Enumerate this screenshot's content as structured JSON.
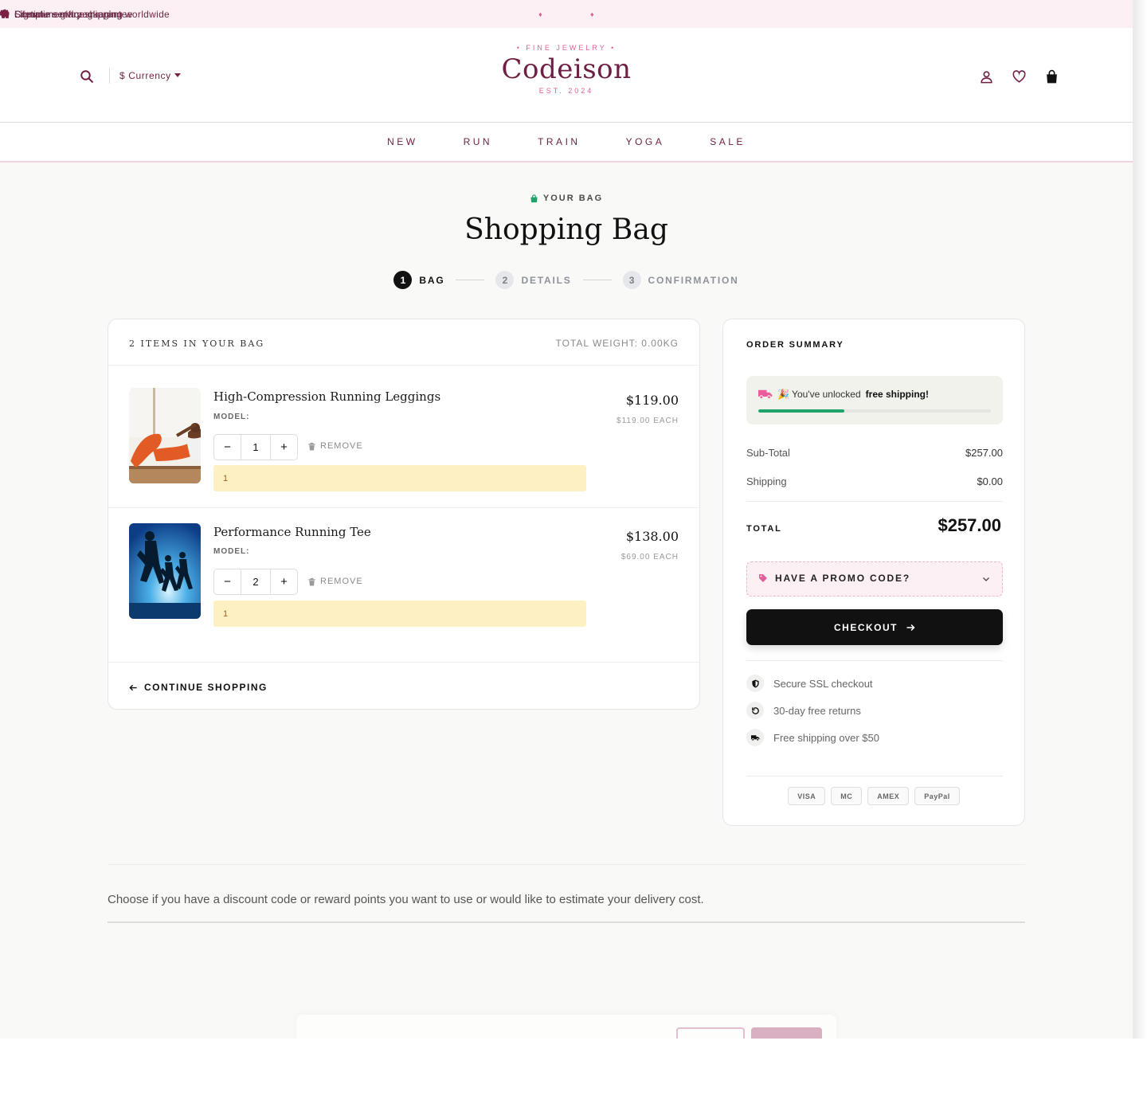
{
  "announcement": {
    "items": [
      "Complimentary shipping worldwide",
      "Signature gift packaging",
      "Lifetime service guarantee"
    ],
    "separator": "♦"
  },
  "header": {
    "currency_label": "$ Currency",
    "logo_top": "• FINE JEWELRY •",
    "logo": "Codeison",
    "logo_est": "EST. 2024"
  },
  "nav": [
    "NEW",
    "RUN",
    "TRAIN",
    "YOGA",
    "SALE"
  ],
  "page": {
    "eyebrow": "YOUR BAG",
    "title": "Shopping Bag"
  },
  "steps": [
    {
      "num": "1",
      "label": "BAG"
    },
    {
      "num": "2",
      "label": "DETAILS"
    },
    {
      "num": "3",
      "label": "CONFIRMATION"
    }
  ],
  "bag": {
    "count_label": "2 ITEMS IN YOUR BAG",
    "weight_label": "TOTAL WEIGHT: 0.00KG",
    "items": [
      {
        "name": "High-Compression Running Leggings",
        "model": "MODEL:",
        "qty": "1",
        "remove": "REMOVE",
        "note": "1",
        "price": "$119.00",
        "each": "$119.00 EACH"
      },
      {
        "name": "Performance Running Tee",
        "model": "MODEL:",
        "qty": "2",
        "remove": "REMOVE",
        "note": "1",
        "price": "$138.00",
        "each": "$69.00 EACH"
      }
    ],
    "continue": "CONTINUE SHOPPING"
  },
  "summary": {
    "title": "ORDER SUMMARY",
    "free_ship_prefix": "🎉 You've unlocked",
    "free_ship_bold": "free shipping!",
    "free_ship_progress": 0.37,
    "subtotal_label": "Sub-Total",
    "subtotal": "$257.00",
    "shipping_label": "Shipping",
    "shipping": "$0.00",
    "total_label": "TOTAL",
    "total": "$257.00",
    "promo_label": "HAVE A PROMO CODE?",
    "checkout_label": "CHECKOUT",
    "trust": [
      "Secure SSL checkout",
      "30-day free returns",
      "Free shipping over $50"
    ],
    "payments": [
      "VISA",
      "MC",
      "AMEX",
      "PayPal"
    ]
  },
  "bottom": {
    "text": "Choose if you have a discount code or reward points you want to use or would like to estimate your delivery cost."
  },
  "colors": {
    "brand": "#6e1f43",
    "accent_pink": "#e0609a",
    "progress_green": "#1fa36b",
    "note_yellow": "#fdf0c3"
  }
}
